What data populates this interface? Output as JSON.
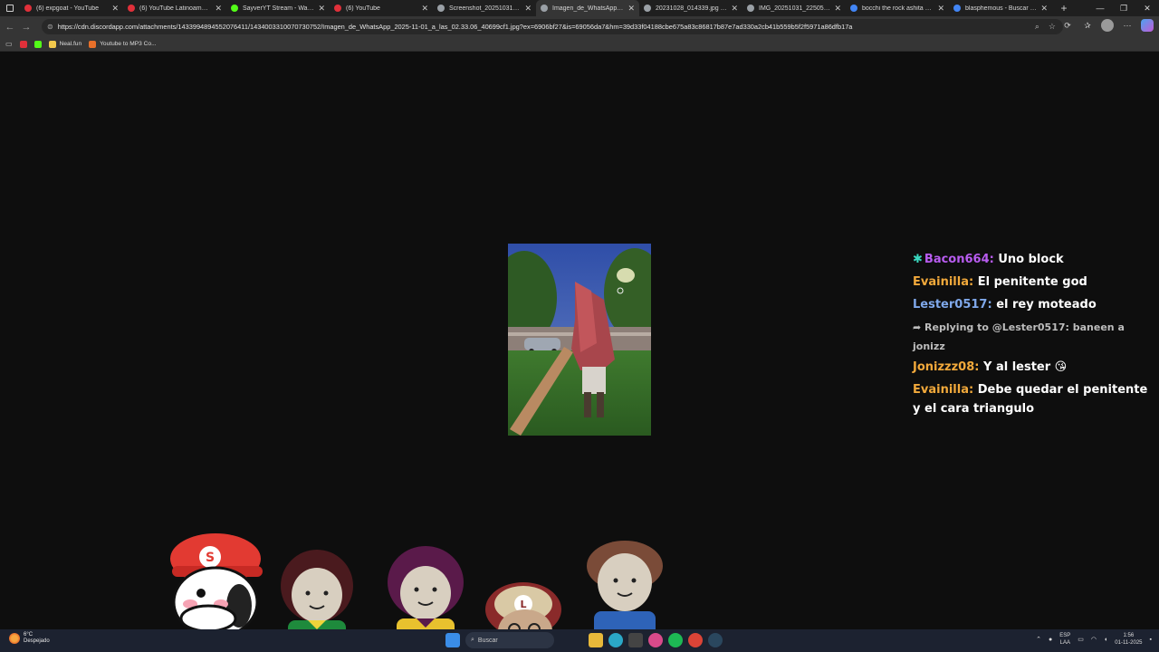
{
  "tabs": [
    {
      "title": "(6) expgoat - YouTube",
      "fav_color": "#e0303a"
    },
    {
      "title": "(6) YouTube Latinoamérica",
      "fav_color": "#e0303a"
    },
    {
      "title": "SayverYT Stream - Watch Li...",
      "fav_color": "#53fc18"
    },
    {
      "title": "(6) YouTube",
      "fav_color": "#e0303a"
    },
    {
      "title": "Screenshot_20251031-194...",
      "fav_color": "#9aa0a6"
    },
    {
      "title": "Imagen_de_WhatsApp_202...",
      "fav_color": "#9aa0a6"
    },
    {
      "title": "20231028_014339.jpg (228...",
      "fav_color": "#9aa0a6"
    },
    {
      "title": "IMG_20251031_225051.jpg",
      "fav_color": "#9aa0a6"
    },
    {
      "title": "bocchi the rock ashita no jo...",
      "fav_color": "#4285f4"
    },
    {
      "title": "blasphemous - Buscar con...",
      "fav_color": "#4285f4"
    }
  ],
  "address_bar": {
    "url": "https://cdn.discordapp.com/attachments/1433994894552076411/1434003310070730752/Imagen_de_WhatsApp_2025-11-01_a_las_02.33.06_40699cf1.jpg?ex=6906bf27&is=69056da7&hm=39d33f04188cbe675a83c86817b87e7ad330a2cb41b559b5f2f5971a86dfb17a"
  },
  "bookmarks": [
    {
      "label": "",
      "icon": "youtube-icon",
      "color": "#e0303a"
    },
    {
      "label": "",
      "icon": "kick-icon",
      "color": "#53fc18"
    },
    {
      "label": "Neal.fun",
      "icon": "neal-icon",
      "color": "#f2c94c"
    },
    {
      "label": "Youtube to MP3 Co...",
      "icon": "converter-icon",
      "color": "#e8702a"
    }
  ],
  "chat": [
    {
      "user": "Bacon664:",
      "user_color": "#b85cf0",
      "text": "Uno block",
      "badge": "star-icon"
    },
    {
      "user": "Evainilla:",
      "user_color": "#f2a93b",
      "text": "El penitente god"
    },
    {
      "user": "Lester0517:",
      "user_color": "#7fa8ea",
      "text": "el rey moteado"
    },
    {
      "reply": "Replying to @Lester0517: baneen a jonizz"
    },
    {
      "user": "Jonizzz08:",
      "user_color": "#f2a93b",
      "text": "Y al lester 😘"
    },
    {
      "user": "Evainilla:",
      "user_color": "#f2a93b",
      "text": "Debe quedar el penitente y el cara triangulo"
    }
  ],
  "taskbar": {
    "weather_temp": "6°C",
    "weather_desc": "Despejado",
    "search_placeholder": "Buscar",
    "lang_top": "ESP",
    "lang_bottom": "LAA",
    "time": "1:56",
    "date": "01-11-2025"
  }
}
